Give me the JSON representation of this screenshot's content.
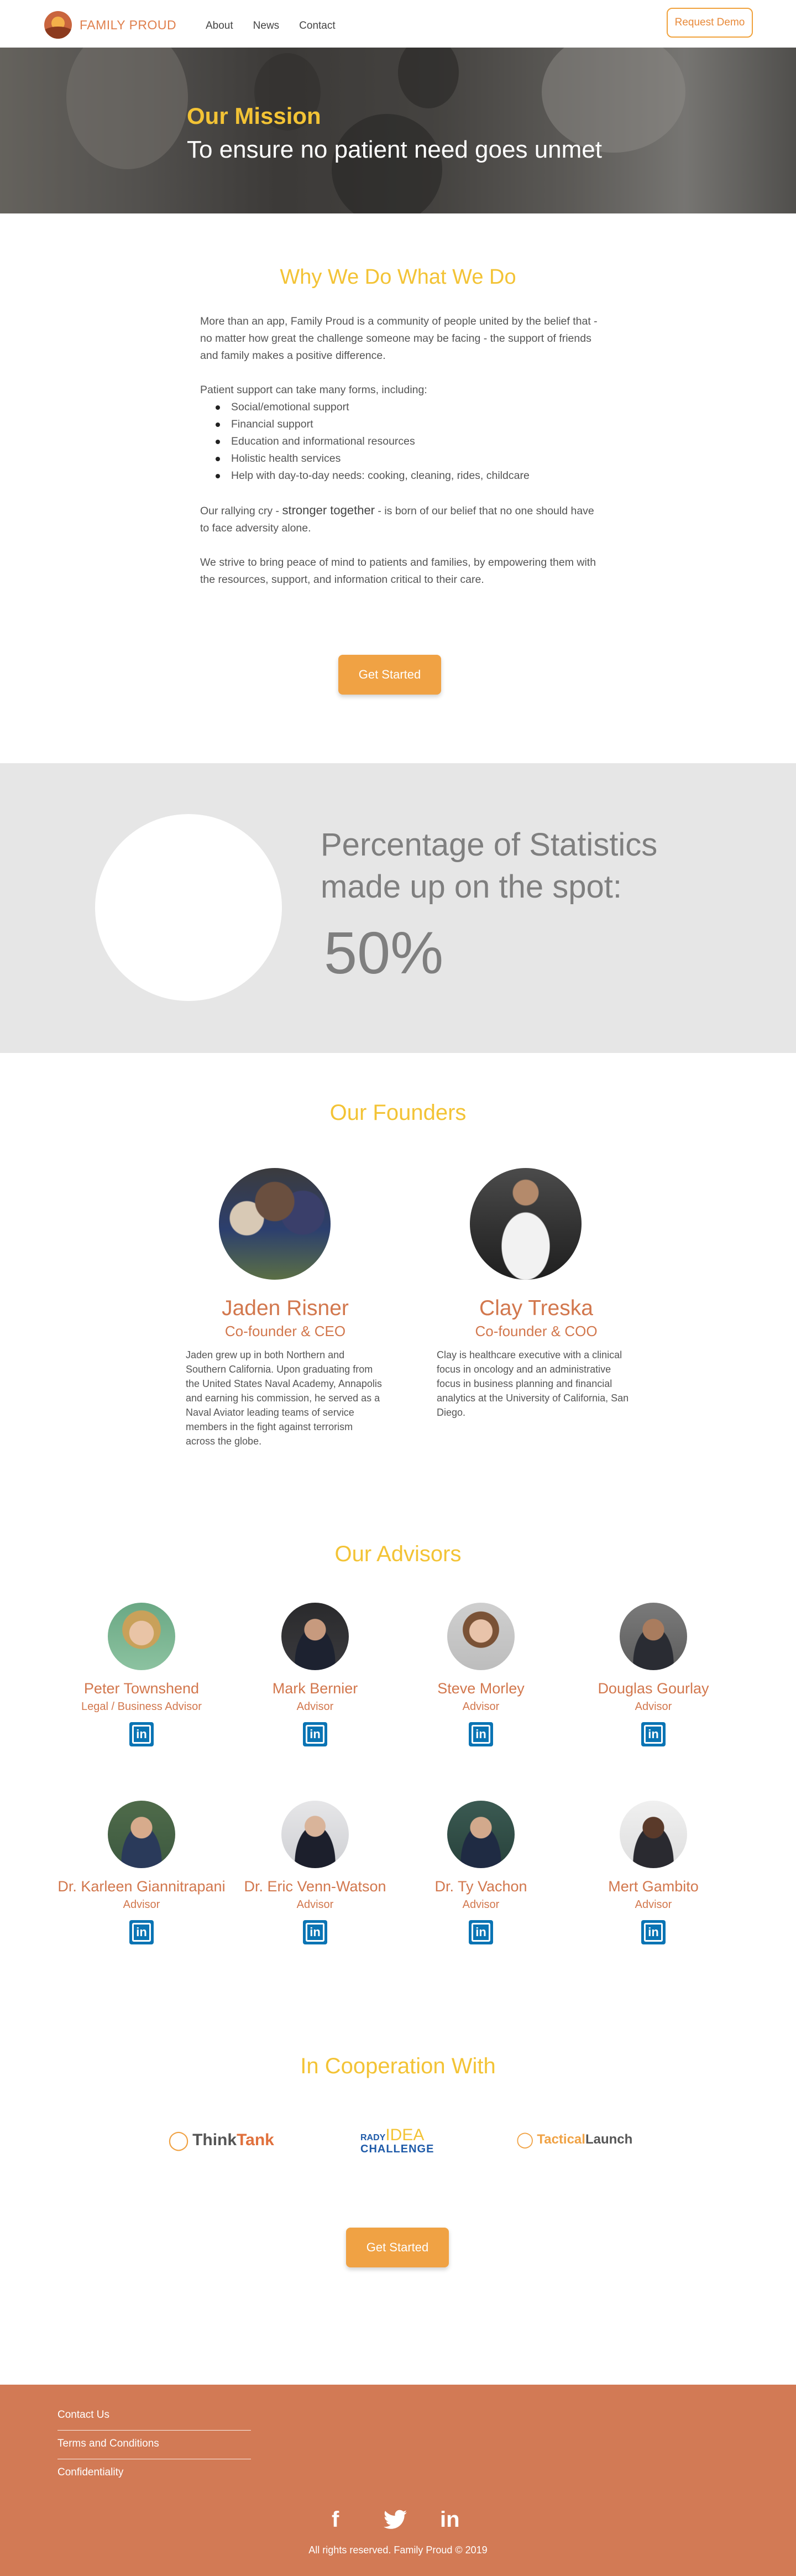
{
  "brand": {
    "name": "FAMILY PROUD"
  },
  "nav": {
    "links": [
      "About",
      "News",
      "Contact"
    ],
    "demo_label": "Request Demo"
  },
  "hero": {
    "kicker": "Our Mission",
    "title": "To ensure no patient need goes unmet"
  },
  "why": {
    "title": "Why We Do What We Do",
    "p1": "More than an app, Family Proud is a community of people united by the belief that  - no matter how great the challenge someone may be facing - the support of friends and family makes a positive difference.",
    "p2": "Patient support can take many forms, including:",
    "bullets": [
      "Social/emotional support",
      "Financial support",
      "Education and informational resources",
      "Holistic health services",
      "Help with day-to-day needs: cooking, cleaning, rides, childcare"
    ],
    "p3_before": "Our rallying cry - ",
    "p3_strong": "stronger together",
    "p3_after": " - is born of our belief that no one should have to face adversity alone.",
    "p4": "We strive to bring peace of mind to patients and families, by empowering them with the resources, support, and information critical to their care.",
    "cta": "Get Started"
  },
  "stats": {
    "heading": "Percentage of Statistics made up on the spot:",
    "value": "50%"
  },
  "founders": {
    "title": "Our Founders",
    "items": [
      {
        "name": "Jaden Risner",
        "role": "Co-founder & CEO",
        "bio": "Jaden grew up in both Northern and Southern California. Upon graduating from the United States Naval Academy, Annapolis and earning his commission, he served as a Naval Aviator leading teams of service members in the fight against terrorism across the globe."
      },
      {
        "name": "Clay Treska",
        "role": "Co-founder & COO",
        "bio": "Clay is healthcare executive with a clinical focus in oncology and an administrative focus in business planning and financial analytics at the University of California, San Diego."
      }
    ]
  },
  "advisors": {
    "title": "Our Advisors",
    "linkedin_glyph": "in",
    "items": [
      {
        "name": "Peter Townshend",
        "role": "Legal / Business Advisor"
      },
      {
        "name": "Mark Bernier",
        "role": "Advisor"
      },
      {
        "name": "Steve Morley",
        "role": "Advisor"
      },
      {
        "name": "Douglas Gourlay",
        "role": "Advisor"
      },
      {
        "name": "Dr. Karleen Giannitrapani",
        "role": "Advisor"
      },
      {
        "name": "Dr. Eric Venn-Watson",
        "role": "Advisor"
      },
      {
        "name": "Dr. Ty Vachon",
        "role": "Advisor"
      },
      {
        "name": "Mert Gambito",
        "role": "Advisor"
      }
    ]
  },
  "cooperation": {
    "title": "In Cooperation With",
    "partners": [
      {
        "a": "Think",
        "b": "Tank"
      },
      {
        "a": "RADY",
        "b": "IDEA",
        "c": "CHALLENGE"
      },
      {
        "a": "Tactical",
        "b": "Launch"
      }
    ],
    "cta": "Get Started"
  },
  "footer": {
    "links": [
      "Contact Us",
      "Terms and Conditions",
      "Confidentiality"
    ],
    "social": [
      "f",
      "twitter-bird",
      "in"
    ],
    "copyright": "All rights reserved. Family Proud © 2019"
  },
  "colors": {
    "accent_yellow": "#f3c335",
    "accent_orange": "#f0a244",
    "footer": "#d27a55",
    "name_orange": "#d2774d",
    "linkedin": "#0a74b4"
  }
}
